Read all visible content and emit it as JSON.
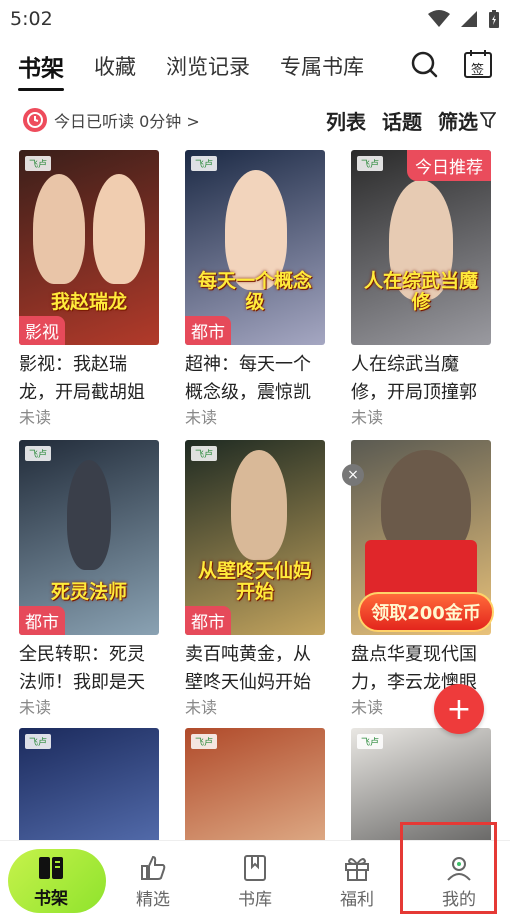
{
  "status_bar": {
    "time": "5:02"
  },
  "tabs": [
    {
      "label": "书架",
      "active": true
    },
    {
      "label": "收藏",
      "active": false
    },
    {
      "label": "浏览记录",
      "active": false
    },
    {
      "label": "专属书库",
      "active": false
    }
  ],
  "top_actions": {
    "search_icon": "search-icon",
    "checkin_label": "签"
  },
  "sub_bar": {
    "listen_text": "今日已听读 0分钟 >",
    "list_label": "列表",
    "topic_label": "话题",
    "filter_label": "筛选"
  },
  "books": [
    {
      "title": "影视：我赵瑞龙，开局截胡姐",
      "status": "未读",
      "genre": "影视",
      "cover_text": "我赵瑞龙",
      "cover_colors": [
        "#3a1f1a",
        "#b23a2a"
      ]
    },
    {
      "title": "超神：每天一个概念级，震惊凯",
      "status": "未读",
      "genre": "都市",
      "cover_text": "每天一个概念级",
      "cover_colors": [
        "#1c2a45",
        "#a5a7c2"
      ]
    },
    {
      "title": "人在综武当魔修，开局顶撞郭",
      "status": "未读",
      "badge": "今日推荐",
      "cover_text": "人在综武当魔修",
      "cover_colors": [
        "#2a2a2a",
        "#9a9aa0"
      ]
    },
    {
      "title": "全民转职：死灵法师！我即是天",
      "status": "未读",
      "genre": "都市",
      "cover_text": "死灵法师",
      "cover_colors": [
        "#222c3a",
        "#8aa2b3"
      ]
    },
    {
      "title": "卖百吨黄金，从壁咚天仙妈开始",
      "status": "未读",
      "genre": "都市",
      "cover_text": "从壁咚天仙妈开始",
      "cover_colors": [
        "#1e2a22",
        "#c3a45e"
      ]
    },
    {
      "title": "盘点华夏现代国力，李云龙懊眼",
      "status": "未读",
      "cover_text": "",
      "cover_colors": [
        "#5a5a52",
        "#e9c27a"
      ]
    },
    {
      "title": "",
      "status": "",
      "cover_text": "",
      "cover_colors": [
        "#1b2a5c",
        "#6d8ad0"
      ]
    },
    {
      "title": "",
      "status": "",
      "cover_text": "",
      "cover_colors": [
        "#b04a2a",
        "#f3d7b0"
      ]
    },
    {
      "title": "",
      "status": "",
      "cover_text": "",
      "cover_colors": [
        "#e9e7e3",
        "#2a2a2a"
      ]
    }
  ],
  "promo": {
    "coin_text": "领取200金币",
    "close_label": "×",
    "fab_label": "+"
  },
  "bottom_nav": [
    {
      "label": "书架",
      "icon": "bookshelf-icon",
      "active": true
    },
    {
      "label": "精选",
      "icon": "thumbs-up-icon",
      "active": false
    },
    {
      "label": "书库",
      "icon": "library-icon",
      "active": false
    },
    {
      "label": "福利",
      "icon": "gift-icon",
      "active": false
    },
    {
      "label": "我的",
      "icon": "profile-icon",
      "active": false
    }
  ],
  "colors": {
    "accent_red": "#ea4c5c",
    "nav_active_green": "#a6ea34"
  }
}
